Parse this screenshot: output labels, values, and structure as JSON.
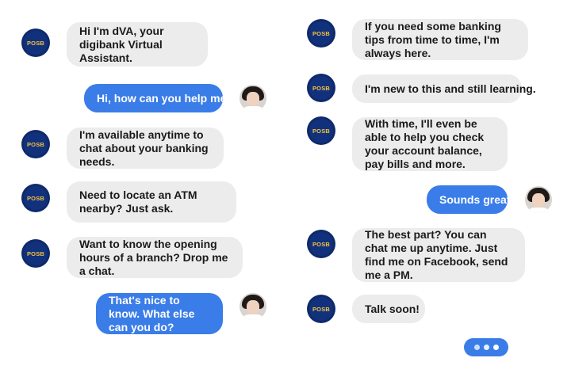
{
  "bot_badge": "POSB",
  "messages": [
    {
      "from": "bot",
      "text": "Hi I'm dVA, your digibank Virtual Assistant."
    },
    {
      "from": "user",
      "text": "Hi, how can you help me?"
    },
    {
      "from": "bot",
      "text": "I'm available anytime to chat about your banking needs."
    },
    {
      "from": "bot",
      "text": "Need to locate an ATM nearby? Just ask."
    },
    {
      "from": "bot",
      "text": "Want to know the opening hours of a branch? Drop me a chat."
    },
    {
      "from": "user",
      "text": "That's nice to know. What else can you do?"
    },
    {
      "from": "bot",
      "text": "If you need some banking tips from time to time, I'm always here."
    },
    {
      "from": "bot",
      "text": "I'm new to this and still learning."
    },
    {
      "from": "bot",
      "text": "With time, I'll even be able to help you check your account balance, pay bills and more."
    },
    {
      "from": "user",
      "text": "Sounds great."
    },
    {
      "from": "bot",
      "text": "The best part? You can chat me up anytime. Just find me on Facebook, send me a PM."
    },
    {
      "from": "bot",
      "text": "Talk soon!"
    }
  ],
  "typing_indicator": "three-dots-icon",
  "colors": {
    "user_bubble": "#3a7de8",
    "bot_bubble": "#ececec",
    "badge_bg": "#0f2a6b",
    "badge_text": "#f6c13a"
  }
}
